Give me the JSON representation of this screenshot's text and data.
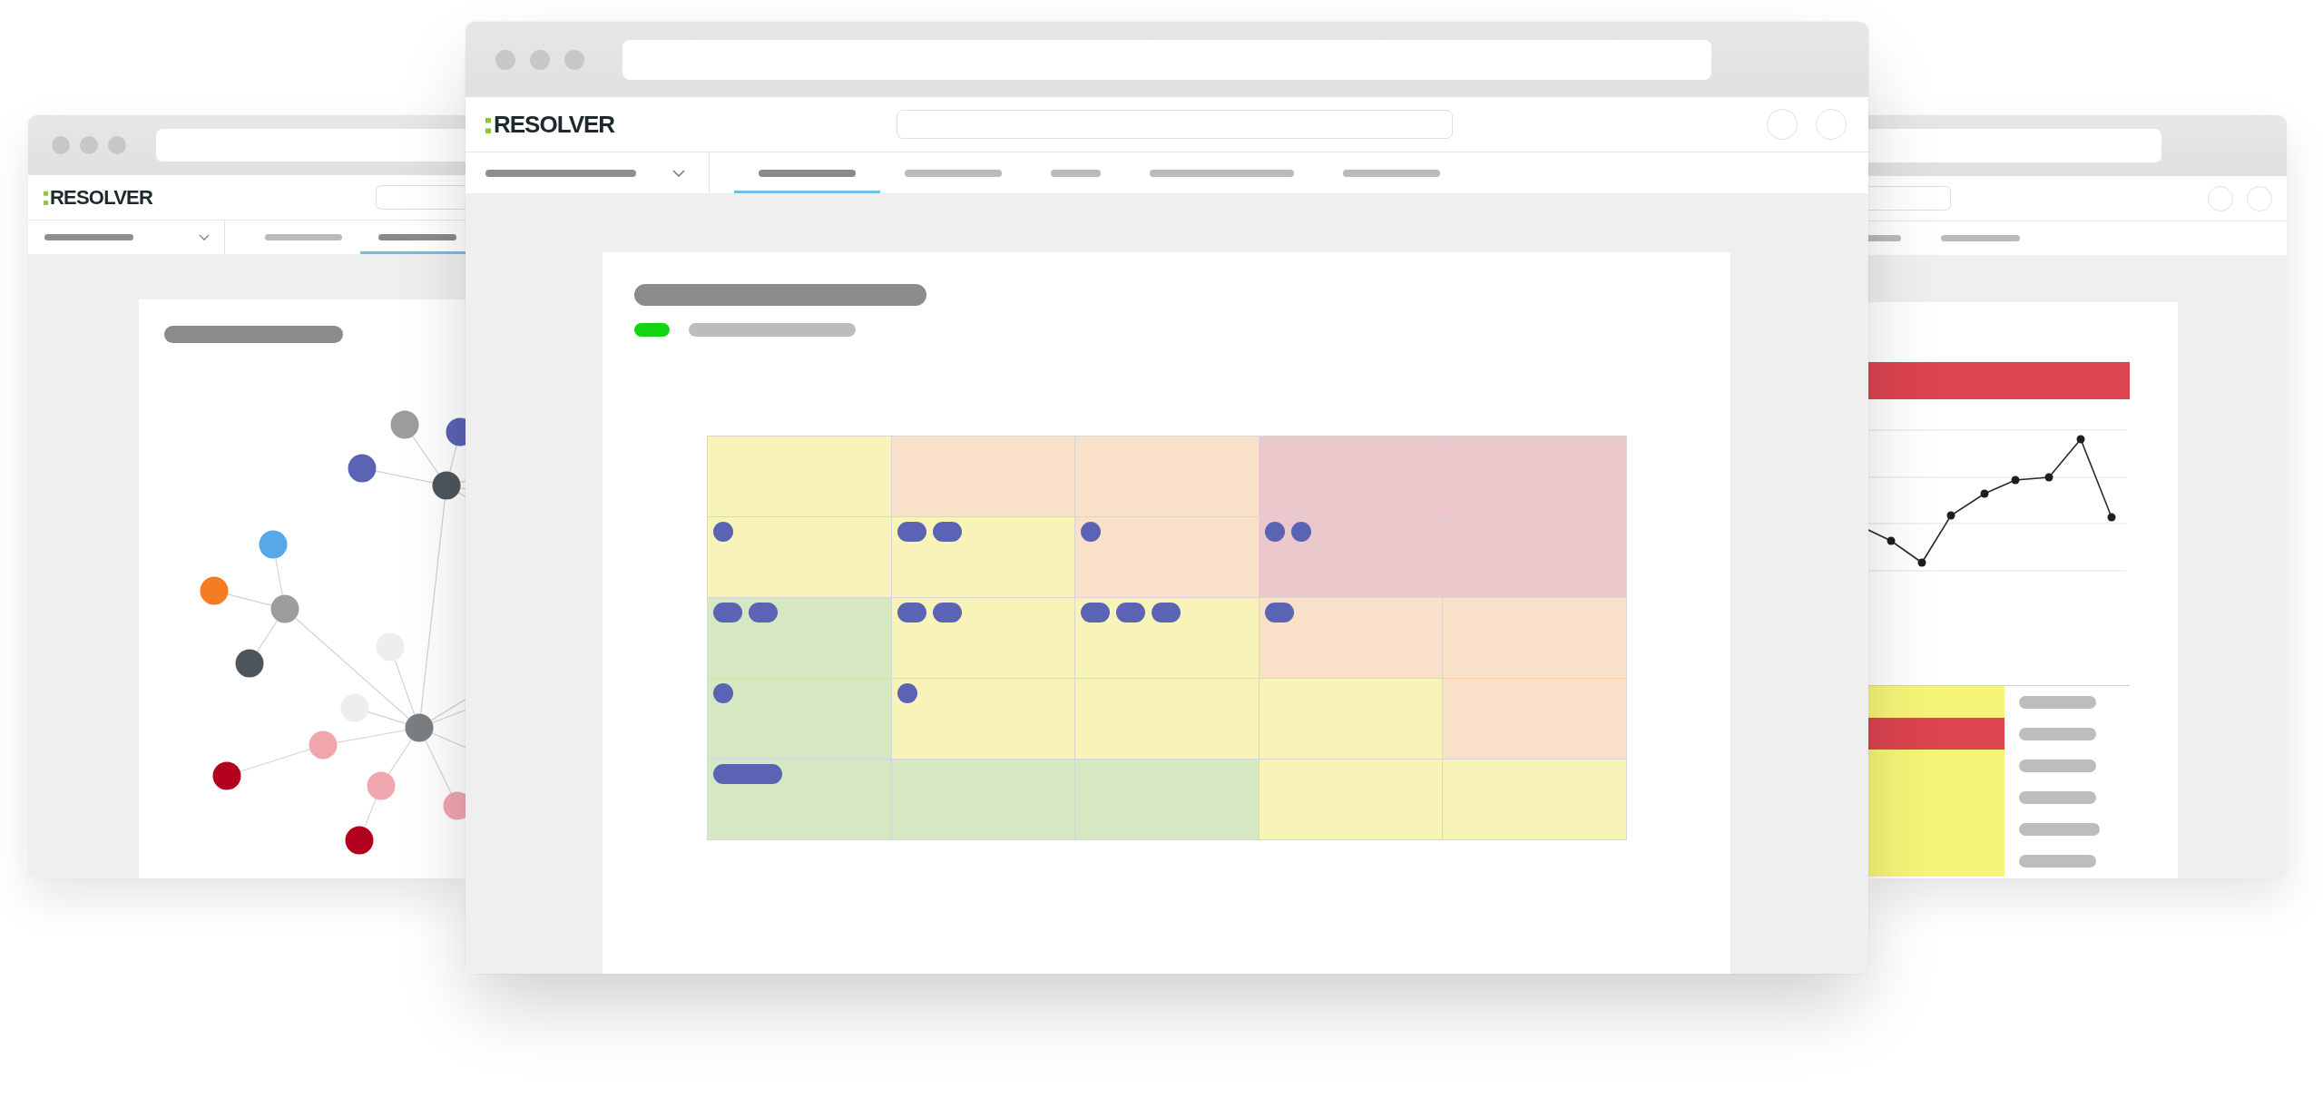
{
  "windows": [
    {
      "kind": "graph",
      "logo": "RESOLVER",
      "tabs": [
        {
          "selected": false
        },
        {
          "selected": true
        }
      ],
      "graph": {
        "nodes": [
          {
            "color": "#9b9d9f"
          },
          {
            "color": "#5b63b4"
          },
          {
            "color": "#5b63b4"
          },
          {
            "color": "#4d575b"
          },
          {
            "color": "#56a8e9"
          },
          {
            "color": "#f47c22"
          },
          {
            "color": "#9b9d9f"
          },
          {
            "color": "#4d575b"
          },
          {
            "color": "#eeeeee"
          },
          {
            "color": "#eeeeee"
          },
          {
            "color": "#7b7f81"
          },
          {
            "color": "#f1a6ad"
          },
          {
            "color": "#b3001e"
          },
          {
            "color": "#f1a6ad"
          },
          {
            "color": "#b3001e"
          },
          {
            "color": "#f1a6ad"
          }
        ]
      }
    },
    {
      "kind": "heatmap",
      "logo": "RESOLVER",
      "tabs": [
        {
          "selected": true
        },
        {
          "selected": false
        },
        {
          "selected": false
        },
        {
          "selected": false
        },
        {
          "selected": false
        }
      ],
      "matrix": {
        "rows": [
          {
            "cells": [
              {
                "color": "#f8f3b9"
              },
              {
                "color": "#f8e1c8"
              },
              {
                "color": "#f8e1c8"
              },
              {
                "color": "#ebc8cc"
              },
              {
                "color": "#ebc8cc"
              }
            ]
          },
          {
            "cells": [
              {
                "color": "#f8f3b9",
                "markers": [
                  {
                    "kind": "dot"
                  }
                ]
              },
              {
                "color": "#f8f3b9",
                "markers": [
                  {
                    "kind": "pill"
                  },
                  {
                    "kind": "pill"
                  }
                ]
              },
              {
                "color": "#f8e1c8",
                "markers": [
                  {
                    "kind": "dot"
                  }
                ]
              },
              {
                "color": "#ebc8cc",
                "markers": [
                  {
                    "kind": "dot"
                  },
                  {
                    "kind": "dot"
                  }
                ]
              },
              {
                "color": "#ebc8cc"
              }
            ]
          },
          {
            "cells": [
              {
                "color": "#d5e8c3",
                "markers": [
                  {
                    "kind": "pill"
                  },
                  {
                    "kind": "pill"
                  }
                ]
              },
              {
                "color": "#f8f3b9",
                "markers": [
                  {
                    "kind": "pill"
                  },
                  {
                    "kind": "pill"
                  }
                ]
              },
              {
                "color": "#f8f3b9",
                "markers": [
                  {
                    "kind": "pill"
                  },
                  {
                    "kind": "pill"
                  },
                  {
                    "kind": "pill"
                  }
                ]
              },
              {
                "color": "#f8e1c8",
                "markers": [
                  {
                    "kind": "pill"
                  }
                ]
              },
              {
                "color": "#f8e1c8"
              }
            ]
          },
          {
            "cells": [
              {
                "color": "#d5e8c3",
                "markers": [
                  {
                    "kind": "dot"
                  }
                ]
              },
              {
                "color": "#f8f3b9",
                "markers": [
                  {
                    "kind": "dot"
                  }
                ]
              },
              {
                "color": "#f8f3b9"
              },
              {
                "color": "#f8f3b9"
              },
              {
                "color": "#f8e1c8"
              }
            ]
          },
          {
            "cells": [
              {
                "color": "#d5e8c3",
                "markers": [
                  {
                    "kind": "bar"
                  }
                ]
              },
              {
                "color": "#d5e8c3"
              },
              {
                "color": "#d5e8c3"
              },
              {
                "color": "#f8f3b9"
              },
              {
                "color": "#f8f3b9"
              }
            ]
          }
        ]
      }
    },
    {
      "kind": "chart",
      "tabs": [
        {
          "selected": false
        },
        {
          "selected": false
        }
      ],
      "table": {
        "rows": [
          {
            "color": "#f7f577"
          },
          {
            "color": "#dc4450"
          },
          {
            "color": "#f7f577"
          },
          {
            "color": "#f7f577"
          },
          {
            "color": "#f7f577"
          },
          {
            "color": "#f7f577"
          }
        ]
      }
    }
  ]
}
